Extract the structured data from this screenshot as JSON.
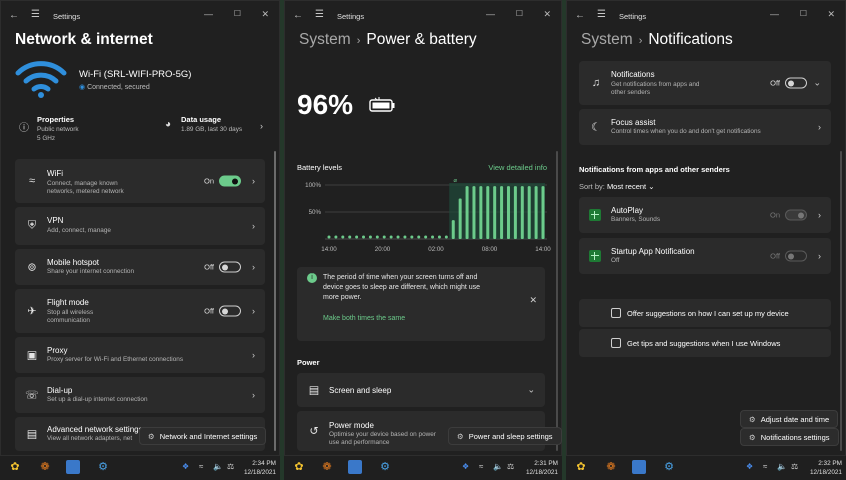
{
  "panel1": {
    "window_title": "Settings",
    "page_title": "Network & internet",
    "wifi": {
      "name": "Wi-Fi (SRL-WIFI-PRO-5G)",
      "status": "Connected, secured"
    },
    "properties": {
      "title": "Properties",
      "line1": "Public network",
      "line2": "5 GHz"
    },
    "data_usage": {
      "title": "Data usage",
      "detail": "1.89 GB, last 30 days"
    },
    "items": [
      {
        "title": "WiFi",
        "sub1": "Connect, manage known",
        "sub2": "networks, metered network",
        "toggle": "On"
      },
      {
        "title": "VPN",
        "sub1": "Add, connect, manage",
        "sub2": ""
      },
      {
        "title": "Mobile hotspot",
        "sub1": "Share your internet connection",
        "sub2": "",
        "toggle": "Off"
      },
      {
        "title": "Flight mode",
        "sub1": "Stop all wireless",
        "sub2": "communication",
        "toggle": "Off"
      },
      {
        "title": "Proxy",
        "sub1": "Proxy server for Wi-Fi and Ethernet connections",
        "sub2": ""
      },
      {
        "title": "Dial-up",
        "sub1": "Set up a dial-up internet connection",
        "sub2": ""
      },
      {
        "title": "Advanced network settings",
        "sub1": "View all network adapters, net",
        "sub2": ""
      }
    ],
    "popup": "Network and Internet settings",
    "clock": {
      "time": "2:34 PM",
      "date": "12/18/2021"
    }
  },
  "panel2": {
    "window_title": "Settings",
    "title_parent": "System",
    "title_current": "Power & battery",
    "battery_percent": "96%",
    "levels_label": "Battery levels",
    "view_detail": "View detailed info",
    "notice": {
      "text1": "The period of time when your screen turns off and",
      "text2": "device goes to sleep are different, which might use",
      "text3": "more power.",
      "action": "Make both times the same"
    },
    "power_heading": "Power",
    "screen_sleep": "Screen and sleep",
    "power_mode": {
      "title": "Power mode",
      "sub1": "Optimise your device based on power",
      "sub2": "use and performance"
    },
    "popup": "Power and sleep settings",
    "clock": {
      "time": "2:31 PM",
      "date": "12/18/2021"
    }
  },
  "chart_data": {
    "type": "bar",
    "title": "Battery levels",
    "x_ticks": [
      "14:00",
      "20:00",
      "02:00",
      "08:00",
      "14:00"
    ],
    "y_ticks": [
      "100%",
      "50%"
    ],
    "ylim": [
      0,
      100
    ],
    "values": [
      3,
      3,
      3,
      3,
      3,
      3,
      3,
      3,
      3,
      3,
      3,
      3,
      3,
      3,
      3,
      3,
      3,
      3,
      35,
      75,
      98,
      98,
      98,
      98,
      98,
      98,
      98,
      98,
      98,
      98,
      98,
      98
    ],
    "highlight_start_index": 18,
    "grid": true
  },
  "panel3": {
    "window_title": "Settings",
    "title_parent": "System",
    "title_current": "Notifications",
    "notifications": {
      "title": "Notifications",
      "sub1": "Get notifications from apps and",
      "sub2": "other senders",
      "toggle": "Off"
    },
    "focus": {
      "title": "Focus assist",
      "sub": "Control times when you do and don't get notifications"
    },
    "apps_heading": "Notifications from apps and other senders",
    "sort_label": "Sort by:",
    "sort_value": "Most recent",
    "apps": [
      {
        "title": "AutoPlay",
        "sub": "Banners, Sounds",
        "toggle": "On"
      },
      {
        "title": "Startup App Notification",
        "sub": "Off",
        "toggle": "Off"
      }
    ],
    "suggest1": "Offer suggestions on how I can set up my device",
    "suggest2": "Get tips and suggestions when I use Windows",
    "popup1": "Adjust date and time",
    "popup2": "Notifications settings",
    "clock": {
      "time": "2:32 PM",
      "date": "12/18/2021"
    }
  },
  "colors": {
    "accent": "#6ccb8b",
    "panel": "#202020",
    "card": "#2b2b2b",
    "wifi_icon": "#2f8fdc"
  }
}
